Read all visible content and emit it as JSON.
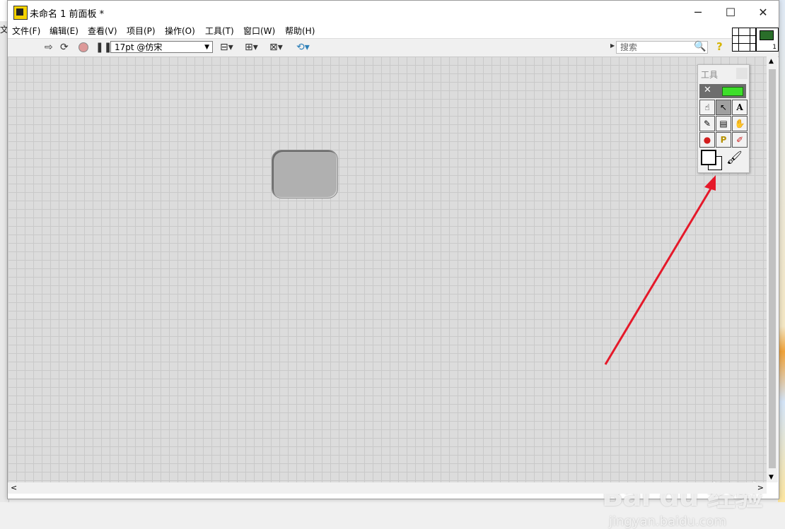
{
  "window": {
    "title": "未命名 1 前面板 *",
    "controls": {
      "minimize": "─",
      "maximize": "☐",
      "close": "✕"
    }
  },
  "background_left_text": "文",
  "menu": [
    "文件(F)",
    "编辑(E)",
    "查看(V)",
    "项目(P)",
    "操作(O)",
    "工具(T)",
    "窗口(W)",
    "帮助(H)"
  ],
  "toolbar": {
    "run_icon": "run-arrow-icon",
    "run_continuous_icon": "run-continuously-icon",
    "abort_icon": "abort-icon",
    "pause_icon": "pause-icon",
    "font_select": "17pt @仿宋",
    "search_placeholder": "搜索",
    "help_symbol": "?"
  },
  "connector_pane": {
    "vi_icon_number": "1"
  },
  "tools_palette": {
    "title": "工具",
    "tools": [
      {
        "name": "operate-value-tool",
        "glyph": "☝",
        "selected": false
      },
      {
        "name": "position-select-tool",
        "glyph": "↖",
        "selected": true
      },
      {
        "name": "edit-text-tool",
        "glyph": "A",
        "selected": false
      },
      {
        "name": "connect-wire-tool",
        "glyph": "✎",
        "selected": false
      },
      {
        "name": "object-shortcut-menu-tool",
        "glyph": "▤",
        "selected": false
      },
      {
        "name": "scroll-window-tool",
        "glyph": "✋",
        "selected": false
      },
      {
        "name": "breakpoint-tool",
        "glyph": "●",
        "selected": false
      },
      {
        "name": "probe-tool",
        "glyph": "P",
        "selected": false
      },
      {
        "name": "get-color-tool",
        "glyph": "✐",
        "selected": false
      }
    ]
  },
  "watermark": {
    "main": "Bai du 经验",
    "sub": "jingyan.baidu.com"
  },
  "colors": {
    "panel_grid": "#dcdcdc",
    "annotation_arrow": "#e5192a",
    "led_green": "#3ddf2a"
  }
}
